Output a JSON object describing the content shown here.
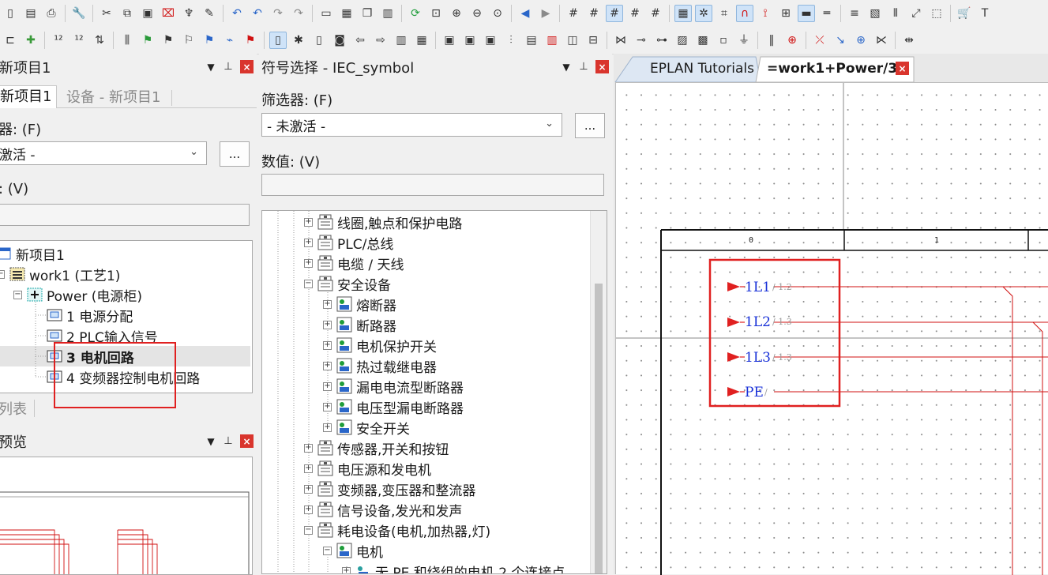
{
  "colors": {
    "accent_red": "#e02020",
    "wire_red": "#d01010",
    "label_blue": "#1a32d8",
    "ref_gray": "#9a9a9a",
    "close_red": "#d9352d",
    "highlight": "#cfe3f8"
  },
  "toolbar1_icons": [
    "new-page-icon",
    "page-properties-icon",
    "print-icon",
    "wrench-icon",
    "cut-icon",
    "copy-icon",
    "paste-icon",
    "delete-icon",
    "format-brush-icon",
    "brush-icon",
    "undo-icon",
    "undo-list-icon",
    "redo-icon",
    "redo-list-icon",
    "window-icon",
    "page-preview-icon",
    "page-copy-icon",
    "table-icon",
    "refresh-icon",
    "zoom-window-icon",
    "zoom-in-icon",
    "zoom-out-icon",
    "zoom-fit-icon",
    "arrow-left-icon",
    "arrow-right-icon",
    "grid-a-icon",
    "grid-b-icon",
    "grid-c-icon",
    "grid-d-icon",
    "grid-e-icon",
    "grid-toggle-icon",
    "snap-icon",
    "hash-icon",
    "magnet-icon",
    "intersection-icon",
    "object-snap-icon",
    "display-icon",
    "frame-icon",
    "text-lines-icon",
    "hatch-icon",
    "align-icon",
    "move-icon",
    "select-region-icon",
    "cart-icon",
    "text-cursor-icon"
  ],
  "toolbar2_icons": [
    "tree-icon",
    "puzzle-icon",
    "number-123-icon",
    "number-12-icon",
    "sort-icon",
    "bus-icon",
    "flag-check-icon",
    "flag-icon",
    "flag-outline-icon",
    "flag-blue-icon",
    "plug-icon",
    "flag-x-icon",
    "page-select-icon",
    "new-star-icon",
    "new-doc-icon",
    "doc-stamp-icon",
    "doc-arrow-icon",
    "doc-out-icon",
    "cabinet-icon",
    "device-grid-icon",
    "box-a-icon",
    "box-b-icon",
    "box-c-icon",
    "terminal-strip-icon",
    "plc-icon",
    "device-red-icon",
    "contact-icon",
    "fuse-icon",
    "bridge-icon",
    "connect-icon",
    "pin-icon",
    "gray-a-icon",
    "hatch-gray-icon",
    "gray-c-icon",
    "ground-icon",
    "line-a-icon",
    "line-b-icon",
    "line-c-icon",
    "arrow-down-icon",
    "cross-icon",
    "node-icon",
    "shield-icon"
  ],
  "project_panel": {
    "title": "新项目1",
    "tabs": [
      "新项目1",
      "设备 - 新项目1"
    ],
    "filter_label": "器: (F)",
    "filter_value": "激活 -",
    "dots": "...",
    "value_label": ": (V)",
    "tree": [
      {
        "label": "新项目1",
        "level": 0,
        "icon": "project-icon"
      },
      {
        "label": "work1 (工艺1)",
        "level": 1,
        "icon": "function-icon"
      },
      {
        "label": "Power (电源柜)",
        "level": 2,
        "icon": "location-icon"
      },
      {
        "label": "1 电源分配",
        "level": 3,
        "icon": "page-icon"
      },
      {
        "label": "2 PLC输入信号",
        "level": 3,
        "icon": "page-icon"
      },
      {
        "label": "3 电机回路",
        "level": 3,
        "icon": "page-icon",
        "selected": true
      },
      {
        "label": "4 变频器控制电机回路",
        "level": 3,
        "icon": "page-icon"
      }
    ],
    "list_tab": "列表"
  },
  "preview_panel": {
    "title": "预览"
  },
  "symbol_panel": {
    "title": "符号选择 - IEC_symbol",
    "filter_label": "筛选器: (F)",
    "filter_value": "- 未激活 -",
    "dots": "...",
    "value_label": "数值: (V)",
    "tree": [
      {
        "label": "线圈,触点和保护电路",
        "level": 0,
        "exp": "+",
        "icon": "folder-icon"
      },
      {
        "label": "PLC/总线",
        "level": 0,
        "exp": "+",
        "icon": "folder-icon"
      },
      {
        "label": "电缆 / 天线",
        "level": 0,
        "exp": "+",
        "icon": "folder-icon"
      },
      {
        "label": "安全设备",
        "level": 0,
        "exp": "−",
        "icon": "folder-icon"
      },
      {
        "label": "熔断器",
        "level": 1,
        "exp": "+",
        "icon": "symbol-image-icon"
      },
      {
        "label": "断路器",
        "level": 1,
        "exp": "+",
        "icon": "symbol-image-icon"
      },
      {
        "label": "电机保护开关",
        "level": 1,
        "exp": "+",
        "icon": "symbol-image-icon"
      },
      {
        "label": "热过载继电器",
        "level": 1,
        "exp": "+",
        "icon": "symbol-image-icon"
      },
      {
        "label": "漏电电流型断路器",
        "level": 1,
        "exp": "+",
        "icon": "symbol-image-icon"
      },
      {
        "label": "电压型漏电断路器",
        "level": 1,
        "exp": "+",
        "icon": "symbol-image-icon"
      },
      {
        "label": "安全开关",
        "level": 1,
        "exp": "+",
        "icon": "symbol-image-icon"
      },
      {
        "label": "传感器,开关和按钮",
        "level": 0,
        "exp": "+",
        "icon": "folder-icon"
      },
      {
        "label": "电压源和发电机",
        "level": 0,
        "exp": "+",
        "icon": "folder-icon"
      },
      {
        "label": "变频器,变压器和整流器",
        "level": 0,
        "exp": "+",
        "icon": "folder-icon"
      },
      {
        "label": "信号设备,发光和发声",
        "level": 0,
        "exp": "+",
        "icon": "folder-icon"
      },
      {
        "label": "耗电设备(电机,加热器,灯)",
        "level": 0,
        "exp": "−",
        "icon": "folder-icon"
      },
      {
        "label": "电机",
        "level": 1,
        "exp": "−",
        "icon": "symbol-image-icon"
      },
      {
        "label": "无 PE 和绕组的电机,2 个连接点",
        "level": 2,
        "exp": "+",
        "icon": "symbol-small-icon"
      }
    ]
  },
  "doc_tabs": [
    {
      "label": "EPLAN Tutorials",
      "active": false
    },
    {
      "label": "=work1+Power/3",
      "active": true
    }
  ],
  "drawing": {
    "columns": [
      "0",
      "1"
    ],
    "potentials": [
      {
        "name": "1L1",
        "ref": "/ 1.2"
      },
      {
        "name": "1L2",
        "ref": "/ 1.3"
      },
      {
        "name": "1L3",
        "ref": "/ 1.3"
      },
      {
        "name": "PE",
        "ref": "/"
      }
    ]
  }
}
